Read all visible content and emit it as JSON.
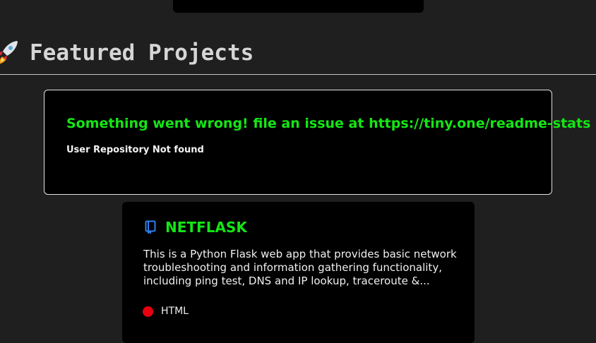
{
  "section": {
    "icon": "rocket-icon",
    "title": "Featured Projects"
  },
  "stats_card": {
    "error_title": "Something went wrong! file an issue at https://tiny.one/readme-stats",
    "error_message": "User Repository Not found",
    "title_color": "#14e614"
  },
  "repo_card": {
    "icon": "repo-book-icon",
    "icon_color": "#2f80ed",
    "name": "NETFLASK",
    "name_color": "#14e614",
    "description": "This is a Python Flask web app that provides basic network troubleshooting and information gathering functionality, including ping test, DNS and IP lookup, traceroute &...",
    "language": "HTML",
    "language_color": "#e8000f"
  }
}
